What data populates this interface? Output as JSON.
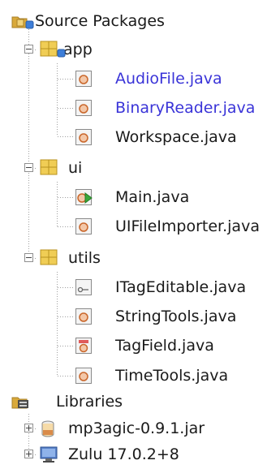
{
  "tree": {
    "root": {
      "label": "Source Packages",
      "icon": "source-packages-icon"
    },
    "packages": [
      {
        "name": "app",
        "icon": "package-icon",
        "files": [
          {
            "label": "AudioFile.java",
            "icon": "java-class-icon",
            "modified": true
          },
          {
            "label": "BinaryReader.java",
            "icon": "java-class-icon",
            "modified": true
          },
          {
            "label": "Workspace.java",
            "icon": "java-class-icon",
            "modified": false
          }
        ]
      },
      {
        "name": "ui",
        "icon": "package-icon",
        "files": [
          {
            "label": "Main.java",
            "icon": "java-main-class-icon",
            "modified": false
          },
          {
            "label": "UIFileImporter.java",
            "icon": "java-class-icon",
            "modified": false
          }
        ]
      },
      {
        "name": "utils",
        "icon": "package-icon",
        "files": [
          {
            "label": "ITagEditable.java",
            "icon": "java-interface-icon",
            "modified": false
          },
          {
            "label": "StringTools.java",
            "icon": "java-class-icon",
            "modified": false
          },
          {
            "label": "TagField.java",
            "icon": "java-enum-icon",
            "modified": false
          },
          {
            "label": "TimeTools.java",
            "icon": "java-class-icon",
            "modified": false
          }
        ]
      }
    ],
    "libraries": {
      "label": "Libraries",
      "icon": "libraries-icon",
      "items": [
        {
          "label": "mp3agic-0.9.1.jar",
          "icon": "jar-icon"
        },
        {
          "label": "Zulu 17.0.2+8",
          "icon": "jdk-platform-icon"
        }
      ]
    }
  },
  "colors": {
    "modified_text": "#3a34d8",
    "package_folder": "#e8c24a",
    "tree_line": "#a0a0a0"
  }
}
